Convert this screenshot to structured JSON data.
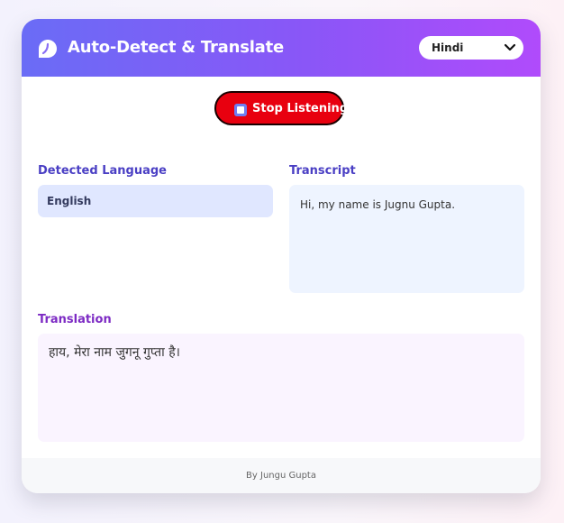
{
  "header": {
    "title": "Auto-Detect & Translate",
    "logo_icon": "chat-bubble-icon",
    "target_language": {
      "selected": "Hindi",
      "icon": "chevron-down-icon"
    }
  },
  "controls": {
    "stop_button_label": "Stop Listening",
    "stop_icon": "stop-icon",
    "stop_button_color": "#e8000f"
  },
  "detected": {
    "label": "Detected Language",
    "value": "English"
  },
  "transcript": {
    "label": "Transcript",
    "value": "Hi, my name is Jugnu Gupta."
  },
  "translation": {
    "label": "Translation",
    "value": "हाय, मेरा नाम जुगनू गुप्ता है।"
  },
  "footer": {
    "credit": "By Jungu Gupta"
  },
  "colors": {
    "header_gradient_start": "#6a6cf6",
    "header_gradient_end": "#b04bfb",
    "label_blue": "#4a3fc4",
    "label_purple": "#7d2bc4"
  }
}
